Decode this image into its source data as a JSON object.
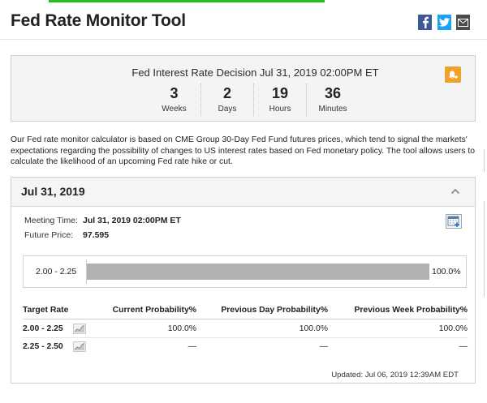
{
  "page": {
    "title": "Fed Rate Monitor Tool"
  },
  "share": {
    "facebook_icon": "facebook-icon",
    "twitter_icon": "twitter-icon",
    "email_icon": "email-icon"
  },
  "countdown": {
    "title": "Fed Interest Rate Decision Jul 31, 2019 02:00PM ET",
    "units": [
      {
        "value": "3",
        "label": "Weeks"
      },
      {
        "value": "2",
        "label": "Days"
      },
      {
        "value": "19",
        "label": "Hours"
      },
      {
        "value": "36",
        "label": "Minutes"
      }
    ]
  },
  "description": "Our Fed rate monitor calculator is based on CME Group 30-Day Fed Fund futures prices, which tend to signal the markets' expectations regarding the possibility of changes to US interest rates based on Fed monetary policy. The tool allows users to calculate the likelihood of an upcoming Fed rate hike or cut.",
  "meeting": {
    "date_heading": "Jul 31, 2019",
    "meeting_time_label": "Meeting Time:",
    "meeting_time_value": "Jul 31, 2019 02:00PM ET",
    "future_price_label": "Future Price:",
    "future_price_value": "97.595"
  },
  "bar": {
    "range": "2.00 - 2.25",
    "value_label": "100.0%",
    "fraction": 1.0
  },
  "table": {
    "headers": [
      "Target Rate",
      "Current Probability%",
      "Previous Day Probability%",
      "Previous Week Probability%"
    ],
    "rows": [
      {
        "rate": "2.00 - 2.25",
        "current": "100.0%",
        "prev_day": "100.0%",
        "prev_week": "100.0%"
      },
      {
        "rate": "2.25 - 2.50",
        "current": "—",
        "prev_day": "—",
        "prev_week": "—"
      }
    ]
  },
  "updated": "Updated: Jul 06, 2019 12:39AM EDT",
  "colors": {
    "accent_green": "#1ec01e",
    "alert_orange": "#f0a12a",
    "facebook": "#3b5998",
    "twitter": "#1da1f2",
    "bar_fill": "#b1b1b1"
  }
}
